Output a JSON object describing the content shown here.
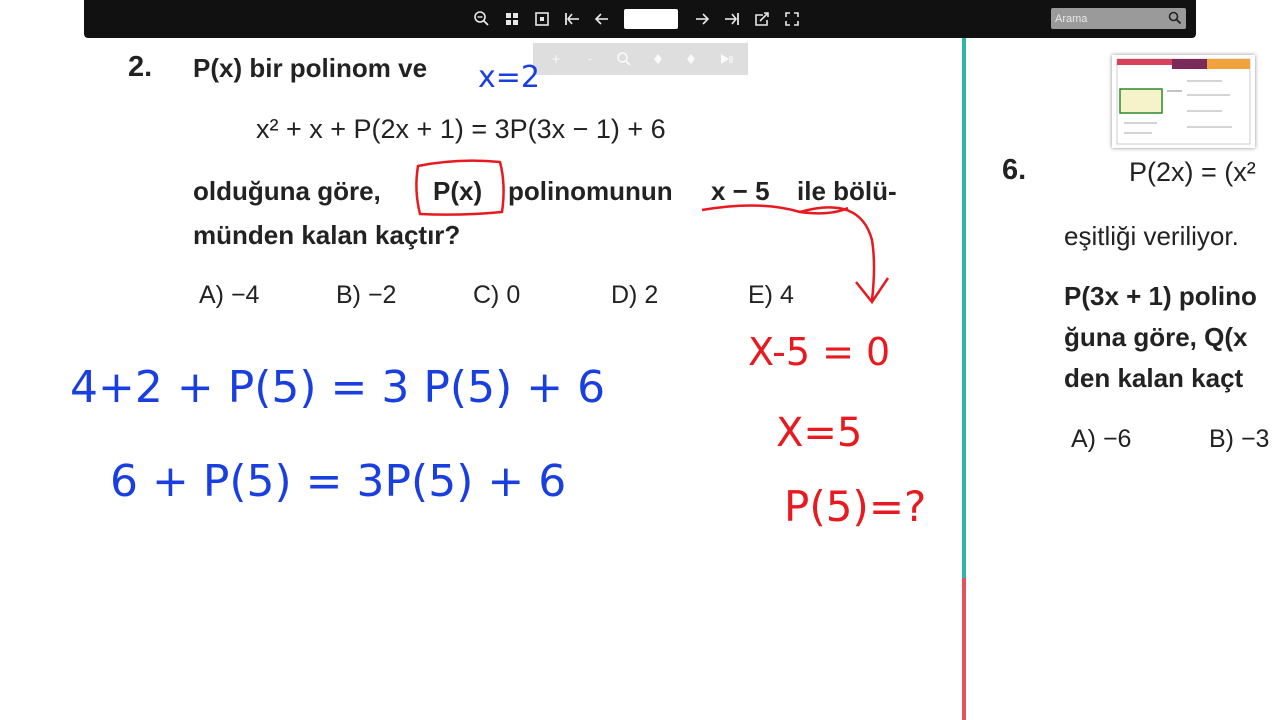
{
  "toolbar": {
    "buttons": {
      "zoom": "zoom-out-icon",
      "thumbnails": "grid-view-icon",
      "fit_page": "fit-page-icon",
      "first": "first-page-icon",
      "prev": "previous-page-icon",
      "next": "next-page-icon",
      "last": "last-page-icon",
      "share": "share-icon",
      "fullscreen": "fullscreen-icon"
    },
    "page_value": "",
    "search_placeholder": "Arama"
  },
  "annotation_toolbar": {
    "buttons": [
      "+",
      "-",
      "zoom-icon",
      "prev-annotation-icon",
      "next-annotation-icon",
      "play-icon"
    ]
  },
  "question2": {
    "number": "2.",
    "line1": "P(x) bir polinom ve",
    "formula": "x² + x + P(2x + 1) = 3P(3x − 1) + 6",
    "line2_a": "olduğuna göre,",
    "line2_boxed": "P(x)",
    "line2_b": "polinomunun",
    "line2_underlined": "x − 5",
    "line2_c": "ile bölü-",
    "line3": "münden kalan kaçtır?",
    "choices": [
      "A) −4",
      "B) −2",
      "C) 0",
      "D) 2",
      "E) 4"
    ]
  },
  "question6": {
    "number": "6.",
    "formula": "P(2x) = (x²",
    "line1": "eşitliği veriliyor.",
    "line2": "P(3x + 1) polino",
    "line3": "ğuna göre, Q(x",
    "line4": "den kalan kaçt",
    "choices": [
      "A) −6",
      "B) −3"
    ]
  },
  "handwriting": {
    "blue_note": "x=2",
    "work_line1": "4+2 + P(5) = 3 P(5) + 6",
    "work_line2": "6 + P(5) = 3P(5) + 6",
    "red_line1": "X-5 = 0",
    "red_line2": "X=5",
    "red_line3": "P(5)=?"
  },
  "colors": {
    "toolbar_bg": "#111111",
    "pen_blue": "#1a3fe0",
    "pen_red": "#e8191f",
    "divider_teal": "#2fb5aa",
    "divider_red": "#e8505b"
  }
}
